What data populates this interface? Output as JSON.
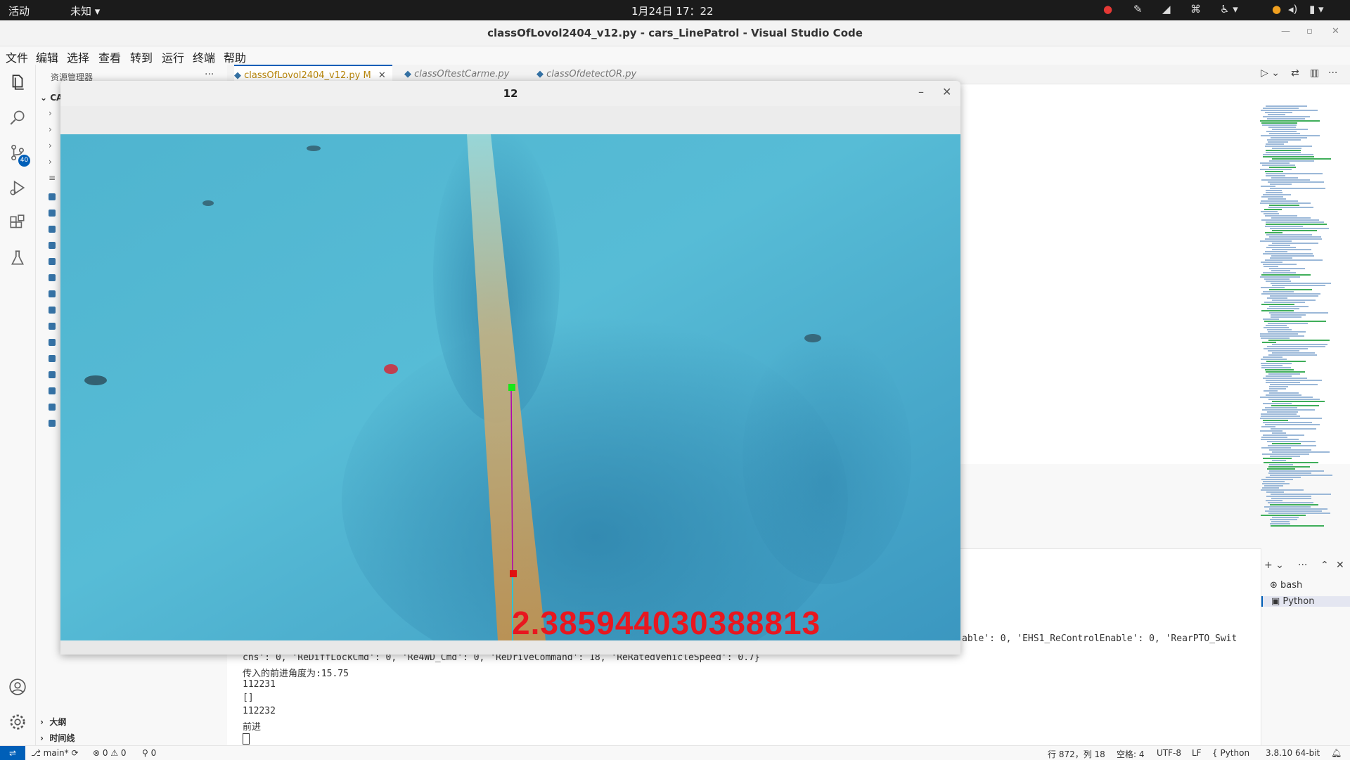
{
  "topbar": {
    "activities": "活动",
    "app_menu": "未知 ▾",
    "clock": "1月24日  17：22"
  },
  "window": {
    "title": "classOfLovol2404_v12.py - cars_LinePatrol - Visual Studio Code"
  },
  "menu": [
    "文件",
    "编辑",
    "选择",
    "查看",
    "转到",
    "运行",
    "终端",
    "帮助"
  ],
  "activity_bar": {
    "scm_badge": "40"
  },
  "sidebar": {
    "header": "资源管理器",
    "more": "···",
    "root_abbrev": "CA",
    "sections": {
      "outline": "大纲",
      "timeline": "时间线"
    }
  },
  "tabs": [
    {
      "label": "classOfLovol2404_v12.py",
      "state": "M"
    },
    {
      "label": "classOftestCarme.py"
    },
    {
      "label": "classOfdetectOR.py"
    }
  ],
  "terminal": {
    "lines": [
      "cns': 0, 'ReDiffLockCmd': 0, 'Re4WD_Cmd': 0, 'ReDriveCommand': 18, 'ReRatedVehicleSpeed': 0.7}",
      "传入的前进角度为:15.75",
      "112231",
      "[]",
      "112232",
      "前进"
    ],
    "right_tail": "able': 0, 'EHS1_ReControlEnable': 0, 'RearPTO_Swit",
    "sessions": [
      "bash",
      "Python"
    ]
  },
  "statusbar": {
    "branch": "main*",
    "errors": "0",
    "warnings": "0",
    "ports": "0",
    "position": "行 872，列 18",
    "spaces": "空格: 4",
    "encoding": "UTF-8",
    "eol": "LF",
    "language": "Python",
    "interpreter": "3.8.10 64-bit"
  },
  "cv_window": {
    "title": "12",
    "overlay_value": "2.385944030388813"
  },
  "colors": {
    "accent": "#005fb8",
    "overlay_text": "#e8171f",
    "marker_top": "#19e619",
    "marker_bottom": "#e01010",
    "guide_line": "#b000b0"
  }
}
